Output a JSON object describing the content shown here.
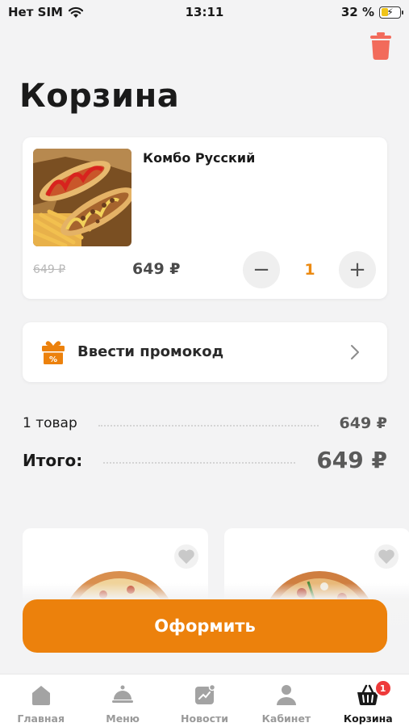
{
  "status_bar": {
    "carrier": "Нет SIM",
    "time": "13:11",
    "battery_percent": "32 %",
    "battery_level": 0.32
  },
  "header": {
    "title": "Корзина",
    "clear_icon": "trash-icon"
  },
  "cart_items": [
    {
      "name": "Комбо Русский",
      "old_price": "649 ₽",
      "price": "649 ₽",
      "quantity": "1",
      "minus_label": "−",
      "plus_label": "+"
    }
  ],
  "promo": {
    "label": "Ввести промокод",
    "icon": "gift-icon"
  },
  "summary": {
    "items_label": "1 товар",
    "items_value": "649 ₽",
    "total_label": "Итого:",
    "total_value": "649 ₽"
  },
  "checkout": {
    "label": "Оформить"
  },
  "tabs": [
    {
      "label": "Главная",
      "icon": "home-icon",
      "active": false
    },
    {
      "label": "Меню",
      "icon": "cloche-icon",
      "active": false
    },
    {
      "label": "Новости",
      "icon": "news-icon",
      "active": false
    },
    {
      "label": "Кабинет",
      "icon": "profile-icon",
      "active": false
    },
    {
      "label": "Корзина",
      "icon": "basket-icon",
      "active": true,
      "badge": "1"
    }
  ],
  "colors": {
    "accent": "#ec810c",
    "quantity": "#ec8a12",
    "trash": "#f26b5b",
    "badge": "#ee3a3a",
    "background": "#f3f3f4"
  }
}
